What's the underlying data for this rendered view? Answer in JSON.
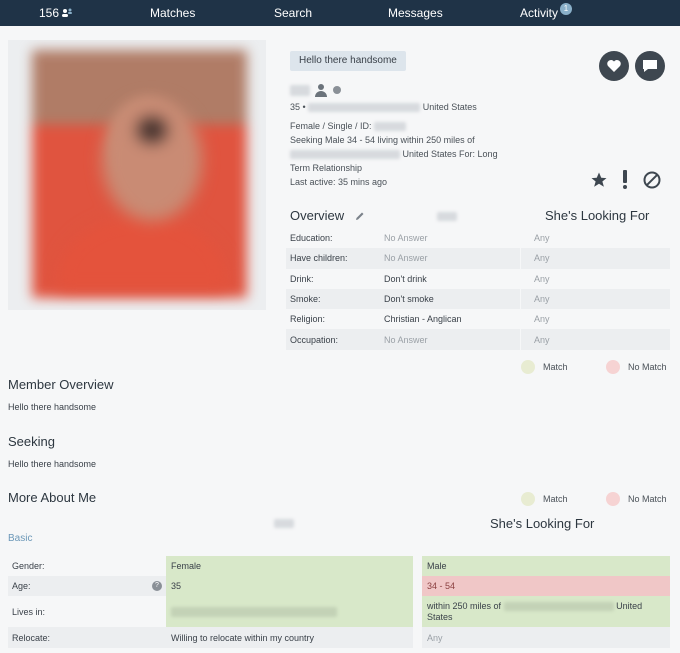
{
  "nav": {
    "count": "156",
    "matches": "Matches",
    "search": "Search",
    "messages": "Messages",
    "activity": "Activity",
    "activity_badge": "1"
  },
  "profile": {
    "tagline": "Hello there handsome",
    "age": "35",
    "separator": "•",
    "country": "United States",
    "line_gender": "Female / Single / ID:",
    "line_seeking": "Seeking Male 34 - 54 living within 250 miles of",
    "line_seeking_country": "United States For: Long",
    "line_term": "Term Relationship",
    "last_active": "Last active: 35 mins ago"
  },
  "overview": {
    "title": "Overview",
    "looking_title": "She's Looking For",
    "rows": [
      {
        "label": "Education:",
        "value": "No Answer",
        "value_na": true,
        "any": "Any"
      },
      {
        "label": "Have children:",
        "value": "No Answer",
        "value_na": true,
        "any": "Any"
      },
      {
        "label": "Drink:",
        "value": "Don't drink",
        "value_na": false,
        "any": "Any"
      },
      {
        "label": "Smoke:",
        "value": "Don't smoke",
        "value_na": false,
        "any": "Any"
      },
      {
        "label": "Religion:",
        "value": "Christian - Anglican",
        "value_na": false,
        "any": "Any"
      },
      {
        "label": "Occupation:",
        "value": "No Answer",
        "value_na": true,
        "any": "Any"
      }
    ]
  },
  "legend": {
    "match": "Match",
    "nomatch": "No Match"
  },
  "member_overview": {
    "title": "Member Overview",
    "text": "Hello there handsome"
  },
  "seeking": {
    "title": "Seeking",
    "text": "Hello there handsome"
  },
  "more_about": {
    "title": "More About Me",
    "looking_title": "She's Looking For",
    "basic": "Basic",
    "gender_label": "Gender:",
    "gender_mine": "Female",
    "gender_theirs": "Male",
    "age_label": "Age:",
    "age_help": "?",
    "age_mine": "35",
    "age_theirs": "34 - 54",
    "lives_label": "Lives in:",
    "lives_theirs_prefix": "within 250 miles of",
    "lives_theirs_suffix": "United States",
    "relocate_label": "Relocate:",
    "relocate_mine": "Willing to relocate within my country",
    "relocate_theirs": "Any"
  }
}
